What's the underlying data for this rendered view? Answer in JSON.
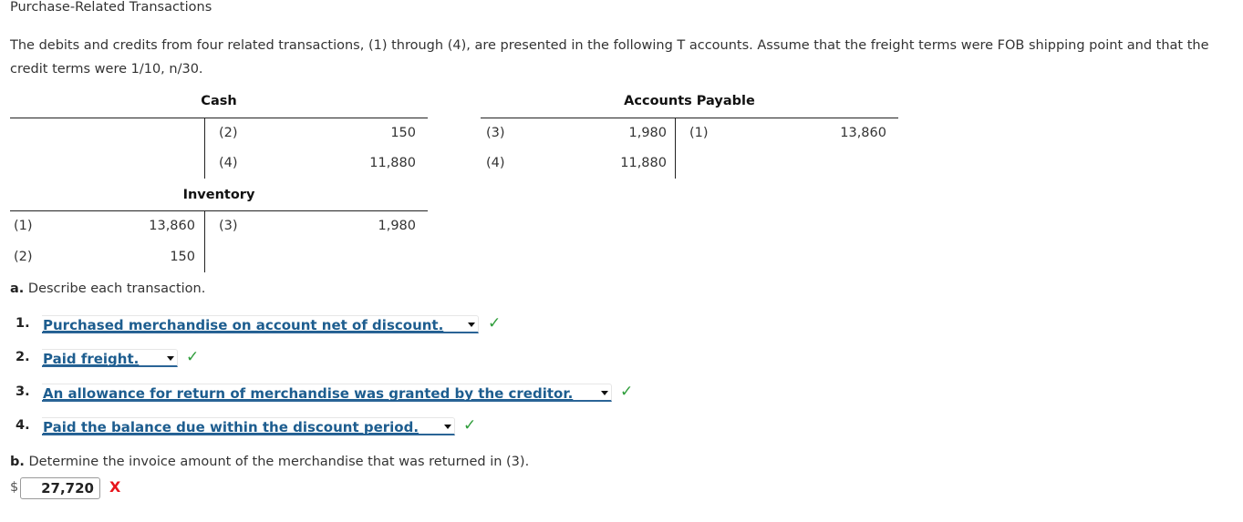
{
  "page": {
    "title": "Purchase-Related Transactions",
    "intro": "The debits and credits from four related transactions, (1) through (4), are presented in the following T accounts. Assume that the freight terms were FOB shipping point and that the credit terms were 1/10, n/30."
  },
  "t_accounts": {
    "cash": {
      "name": "Cash",
      "debits": [],
      "credits": [
        {
          "ref": "(2)",
          "amount": "150"
        },
        {
          "ref": "(4)",
          "amount": "11,880"
        }
      ]
    },
    "accounts_payable": {
      "name": "Accounts Payable",
      "debits": [
        {
          "ref": "(3)",
          "amount": "1,980"
        },
        {
          "ref": "(4)",
          "amount": "11,880"
        }
      ],
      "credits": [
        {
          "ref": "(1)",
          "amount": "13,860"
        }
      ]
    },
    "inventory": {
      "name": "Inventory",
      "debits": [
        {
          "ref": "(1)",
          "amount": "13,860"
        },
        {
          "ref": "(2)",
          "amount": "150"
        }
      ],
      "credits": [
        {
          "ref": "(3)",
          "amount": "1,980"
        }
      ]
    }
  },
  "part_a": {
    "label": "a.",
    "prompt": "Describe each transaction.",
    "items": [
      {
        "number": "1.",
        "selected": "Purchased merchandise on account net of discount.",
        "status": "correct",
        "status_icon": "check-icon",
        "status_glyph": "✓"
      },
      {
        "number": "2.",
        "selected": "Paid freight.",
        "status": "correct",
        "status_icon": "check-icon",
        "status_glyph": "✓"
      },
      {
        "number": "3.",
        "selected": "An allowance for return of merchandise was granted by the creditor.",
        "status": "correct",
        "status_icon": "check-icon",
        "status_glyph": "✓"
      },
      {
        "number": "4.",
        "selected": "Paid the balance due within the discount period.",
        "status": "correct",
        "status_icon": "check-icon",
        "status_glyph": "✓"
      }
    ]
  },
  "part_b": {
    "label": "b.",
    "prompt": "Determine the invoice amount of the merchandise that was returned in (3).",
    "currency": "$",
    "value": "27,720",
    "status": "incorrect",
    "status_glyph": "X"
  },
  "colors": {
    "select_text": "#1d5d8f",
    "correct": "#2e9d3a",
    "incorrect": "#e8141b"
  }
}
